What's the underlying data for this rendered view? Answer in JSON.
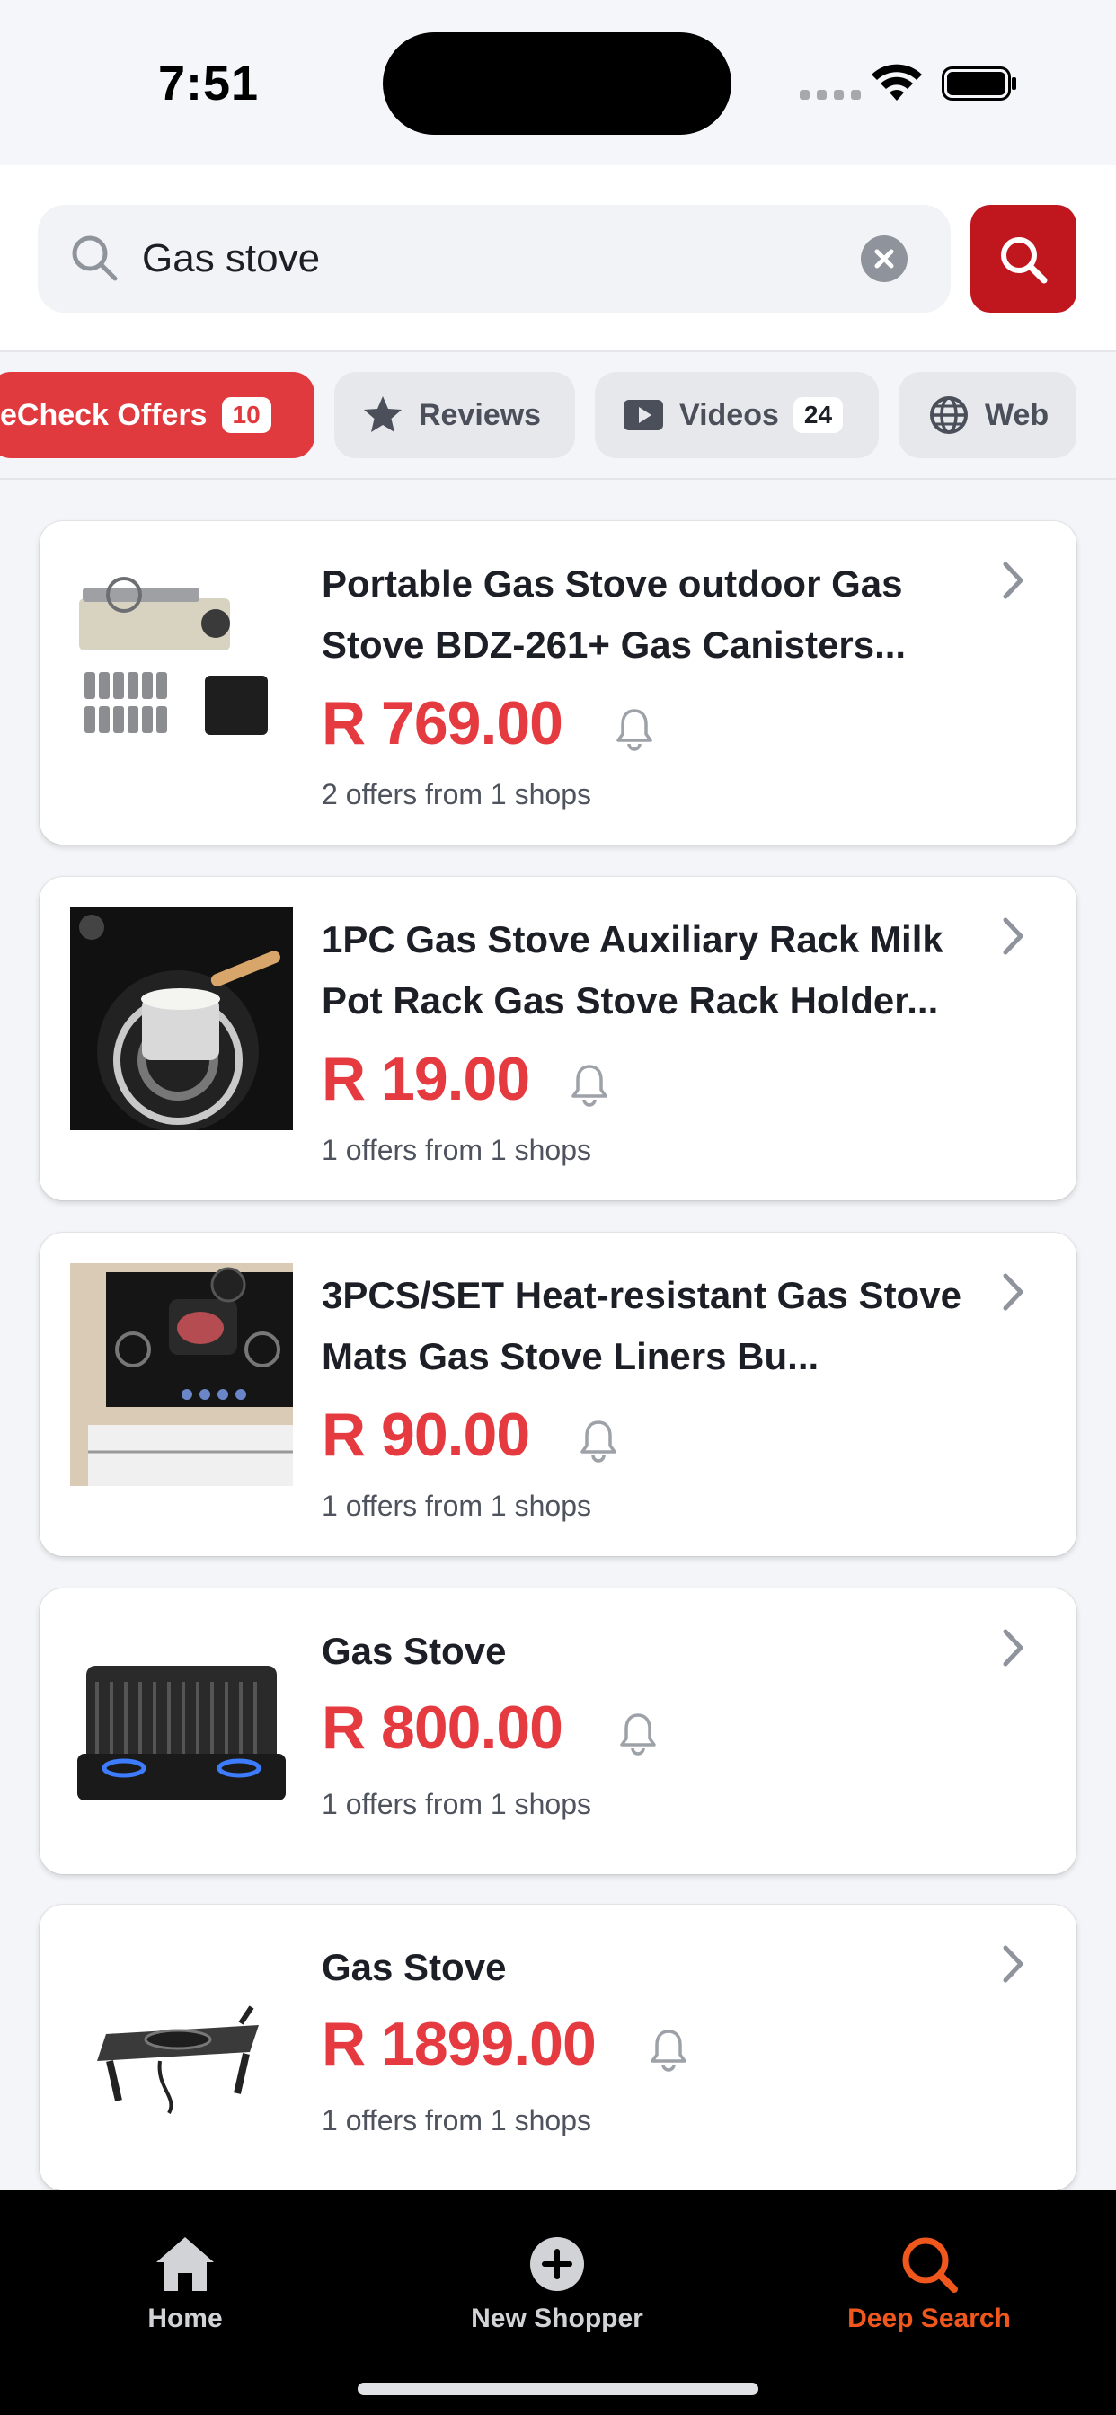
{
  "status_bar": {
    "time": "7:51"
  },
  "search": {
    "query": "Gas stove"
  },
  "chips": [
    {
      "label": "eCheck Offers",
      "count": "10",
      "active": true
    },
    {
      "label": "Reviews",
      "icon": "star-icon"
    },
    {
      "label": "Videos",
      "count": "24",
      "icon": "play-icon"
    },
    {
      "label": "Web",
      "icon": "globe-icon"
    }
  ],
  "products": [
    {
      "title": "Portable Gas Stove outdoor Gas Stove BDZ-261+ Gas Canisters...",
      "price": "R 769.00",
      "offers": "2 offers from 1 shops"
    },
    {
      "title": "1PC Gas Stove Auxiliary Rack Milk Pot Rack Gas Stove Rack Holder...",
      "price": "R 19.00",
      "offers": "1 offers from 1 shops"
    },
    {
      "title": "3PCS/SET Heat-resistant Gas Stove Mats Gas Stove Liners Bu...",
      "price": "R 90.00",
      "offers": "1 offers from 1 shops"
    },
    {
      "title": "Gas Stove",
      "price": "R 800.00",
      "offers": "1 offers from 1 shops"
    },
    {
      "title": "Gas Stove",
      "price": "R 1899.00",
      "offers": "1 offers from 1 shops"
    }
  ],
  "tabbar": {
    "home": "Home",
    "new_shopper": "New Shopper",
    "deep_search": "Deep Search"
  },
  "colors": {
    "brand_red": "#c0161e",
    "price_red": "#e53a3f",
    "active_tab": "#f0571c"
  }
}
